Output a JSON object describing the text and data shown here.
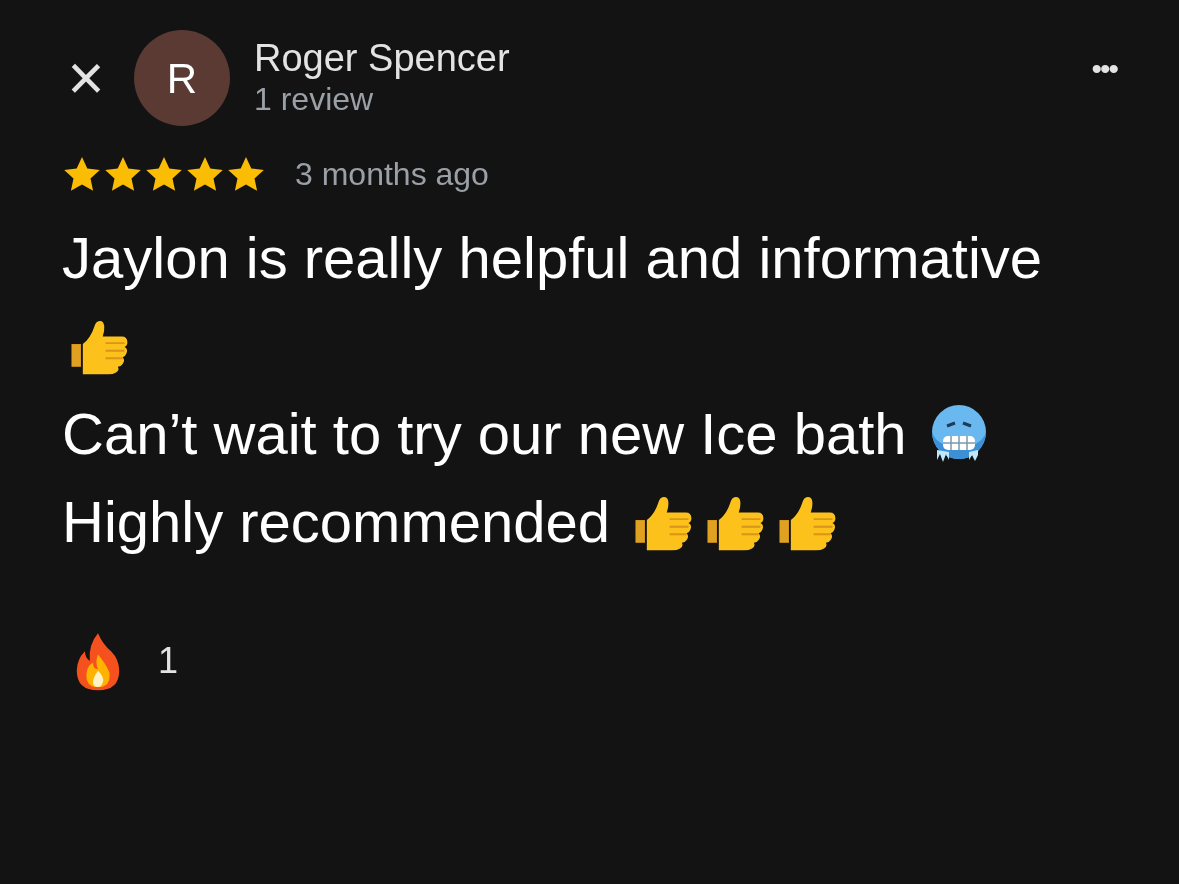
{
  "header": {
    "close": "×",
    "avatar_letter": "R",
    "name": "Roger Spencer",
    "subtitle": "1 review",
    "more": "•••"
  },
  "rating": {
    "stars": 5,
    "time": "3 months ago"
  },
  "review_lines": [
    {
      "parts": [
        {
          "kind": "text",
          "text": "Jaylon is really helpful and informative"
        },
        {
          "kind": "thumbs"
        }
      ]
    },
    {
      "parts": [
        {
          "kind": "text",
          "text": "Can’t wait to try our new Ice bath "
        },
        {
          "kind": "cold"
        }
      ]
    },
    {
      "parts": [
        {
          "kind": "text",
          "text": "Highly recommended "
        },
        {
          "kind": "thumbs"
        },
        {
          "kind": "thumbs"
        },
        {
          "kind": "thumbs"
        }
      ]
    }
  ],
  "reactions": [
    {
      "kind": "fire",
      "count": "1"
    }
  ]
}
